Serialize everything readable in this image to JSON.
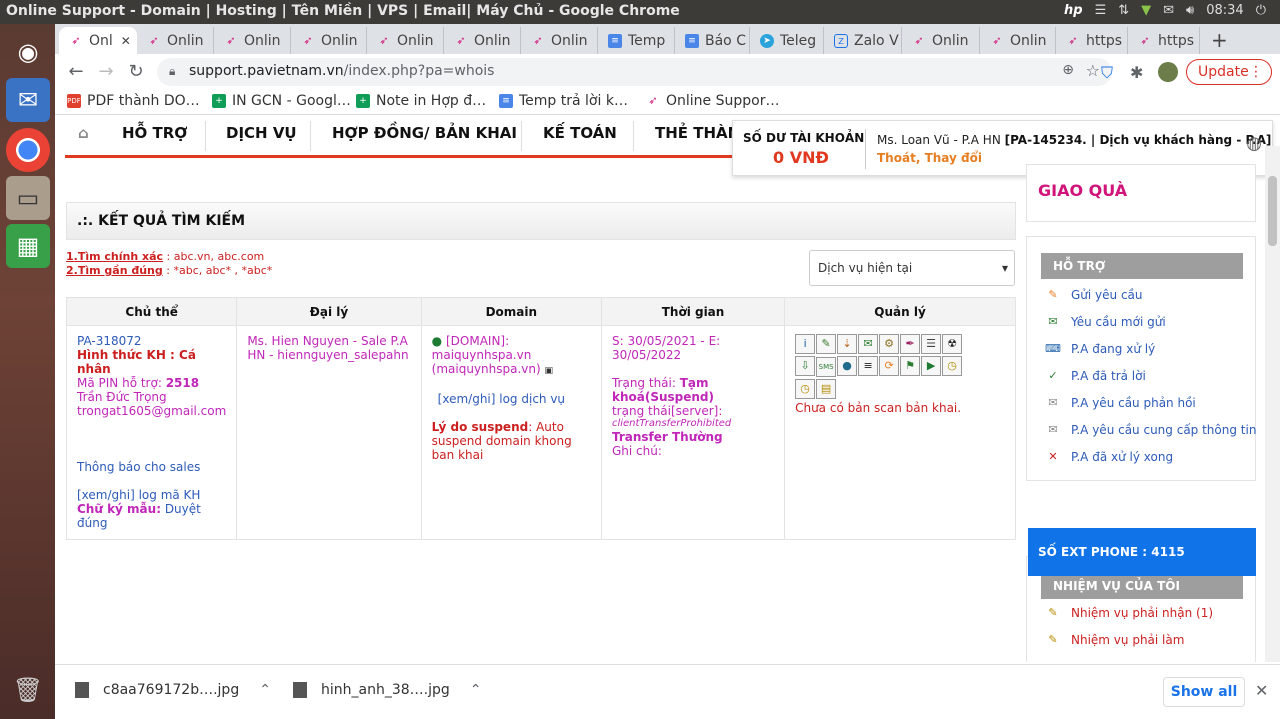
{
  "window": {
    "title": "Online Support - Domain | Hosting | Tên Miền | VPS | Email| Máy Chủ - Google Chrome",
    "clock": "08:34"
  },
  "tabs": [
    {
      "label": "Onl",
      "icon": "pa-icon",
      "active": true
    },
    {
      "label": "Onlin",
      "icon": "pa-icon"
    },
    {
      "label": "Onlin",
      "icon": "pa-icon"
    },
    {
      "label": "Onlin",
      "icon": "pa-icon"
    },
    {
      "label": "Onlin",
      "icon": "pa-icon"
    },
    {
      "label": "Onlin",
      "icon": "pa-icon"
    },
    {
      "label": "Onlin",
      "icon": "pa-icon"
    },
    {
      "label": "Temp",
      "icon": "doc-icon"
    },
    {
      "label": "Báo C",
      "icon": "doc-icon"
    },
    {
      "label": "Teleg",
      "icon": "telegram-icon"
    },
    {
      "label": "Zalo V",
      "icon": "zalo-icon"
    },
    {
      "label": "Onlin",
      "icon": "pa-icon"
    },
    {
      "label": "Onlin",
      "icon": "pa-icon"
    },
    {
      "label": "https",
      "icon": "pa-icon"
    },
    {
      "label": "https",
      "icon": "pa-icon"
    }
  ],
  "address": {
    "host": "support.pavietnam.vn",
    "path": "/index.php?pa=whois"
  },
  "toolbar": {
    "update_label": "Update"
  },
  "bookmarks": [
    {
      "label": "PDF thành DO…",
      "icon": "pdf-icon"
    },
    {
      "label": "IN GCN - Googl…",
      "icon": "sheet-icon"
    },
    {
      "label": "Note in Hợp đ…",
      "icon": "sheet-icon"
    },
    {
      "label": "Temp trả lời k…",
      "icon": "doc-icon"
    },
    {
      "label": "Online Suppor…",
      "icon": "pa-icon"
    }
  ],
  "nav": {
    "items": [
      "HỖ TRỢ",
      "DỊCH VỤ",
      "HỢP ĐỒNG/ BẢN KHAI",
      "KẾ TOÁN",
      "THẺ THÀN"
    ]
  },
  "balance": {
    "label": "SỐ DƯ TÀI KHOẢN",
    "amount": "0 VNĐ",
    "user_prefix": "Ms. Loan Vũ - P.A HN ",
    "user_bold": "[PA-145234. | Dịch vụ khách hàng - P.A]",
    "logout": "Thoát",
    "sep": ", ",
    "change": "Thay đổi"
  },
  "results": {
    "title": ".:. KẾT QUẢ TÌM KIẾM",
    "hint1_key": "1.Tìm chính xác",
    "hint1_val": " : abc.vn, abc.com",
    "hint2_key": "2.Tìm gần đúng",
    "hint2_val": " : *abc, abc* , *abc*",
    "select_value": "Dịch vụ hiện tại"
  },
  "table": {
    "headers": [
      "Chủ thể",
      "Đại lý",
      "Domain",
      "Thời gian",
      "Quản lý"
    ],
    "owner": {
      "id": "PA-318072",
      "type": "Hình thức KH : Cá nhân",
      "pin_label": "Mã PIN hỗ trợ: ",
      "pin": "2518",
      "name": "Trần Đức Trọng",
      "email": "trongat1605@gmail.com",
      "notify": "Thông báo cho sales",
      "log": "[xem/ghi] log mã KH",
      "sig_label": "Chữ ký mẫu:",
      "sig_value": " Duyệt đúng"
    },
    "agent": {
      "line": "Ms. Hien Nguyen - Sale P.A HN - hiennguyen_salepahn"
    },
    "domain": {
      "tag": "[DOMAIN]:",
      "name": "maiquynhspa.vn",
      "name_paren": "(maiquynhspa.vn)",
      "log": "[xem/ghi] log dịch vụ",
      "reason_label": "Lý do suspend",
      "reason": ": Auto suspend domain khong ban khai"
    },
    "time": {
      "range": "S: 30/05/2021 - E: 30/05/2022",
      "status_label": "Trạng thái: ",
      "status": "Tạm khoá(Suspend)",
      "server_label": "trạng thái[server]:",
      "server": "clientTransferProhibited",
      "transfer": "Transfer Thường",
      "note": "Ghi chú:"
    },
    "manage": {
      "icons": [
        "i",
        "✎",
        "⇣",
        "✉",
        "⚙",
        "✒",
        "☰",
        "☢",
        "⇩",
        "SMS",
        "●",
        "≡",
        "⟳",
        "⚑",
        "▶",
        "◷",
        "◷",
        "▤"
      ],
      "note": "Chưa có bản scan bản khai."
    }
  },
  "sidebar": {
    "gift": "GIAO QUÀ",
    "support_head": "HỖ TRỢ",
    "support_items": [
      "Gửi yêu cầu",
      "Yêu cầu mới gửi",
      "P.A đang xử lý",
      "P.A đã trả lời",
      "P.A yêu cầu phản hồi",
      "P.A yêu cầu cung cấp thông tin",
      "P.A đã xử lý xong"
    ],
    "ext_phone": "SỐ EXT PHONE : 4115",
    "tasks_head": "NHIỆM VỤ CỦA TÔI",
    "task_items": [
      "Nhiệm vụ phải nhận (1)",
      "Nhiệm vụ phải làm"
    ]
  },
  "downloads": {
    "items": [
      "c8aa769172b….jpg",
      "hinh_anh_38….jpg"
    ],
    "show_all": "Show all"
  },
  "colors": {
    "accent_red": "#e0391f",
    "brand_magenta": "#d0147a",
    "link_blue": "#2d5bb8",
    "ext_blue": "#1173e8"
  }
}
